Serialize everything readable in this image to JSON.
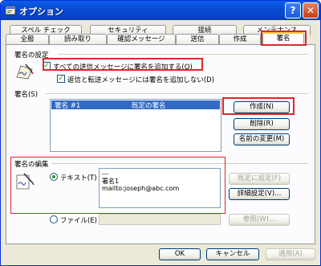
{
  "window": {
    "title": "オプション",
    "help_label": "?",
    "close_label": "✕"
  },
  "tabs": {
    "row1": [
      "スペル チェック",
      "セキュリティ",
      "接続",
      "メンテナンス"
    ],
    "row2": [
      "全般",
      "読み取り",
      "確認メッセージ",
      "送信",
      "作成",
      "署名"
    ],
    "active": "署名"
  },
  "settings": {
    "heading": "署名の設定",
    "add_all": {
      "label": "すべての送信メッセージに署名を追加する(Q)",
      "checked": true
    },
    "no_reply": {
      "label": "返信と転送メッセージには署名を追加しない(D)",
      "checked": true
    }
  },
  "signatures": {
    "heading": "署名(S)",
    "list": [
      {
        "name": "署名 #1",
        "status": "既定の署名"
      }
    ],
    "buttons": {
      "create": "作成(N)",
      "delete": "削除(R)",
      "rename": "名前の変更(M)"
    }
  },
  "edit": {
    "heading": "署名の編集",
    "text_option": "テキスト(T)",
    "text_content": [
      "---",
      "署名1",
      "mailto:joseph@abc.com"
    ],
    "file_option": "ファイル(E)",
    "file_value": "",
    "buttons": {
      "set_default": "既定に設定(F)",
      "advanced": "詳細設定(V)...",
      "browse": "参照(W)..."
    }
  },
  "footer": {
    "ok": "OK",
    "cancel": "キャンセル",
    "apply": "適用(A)"
  },
  "colors": {
    "highlight": "#e0262b",
    "titlebar": "#0848d2"
  }
}
